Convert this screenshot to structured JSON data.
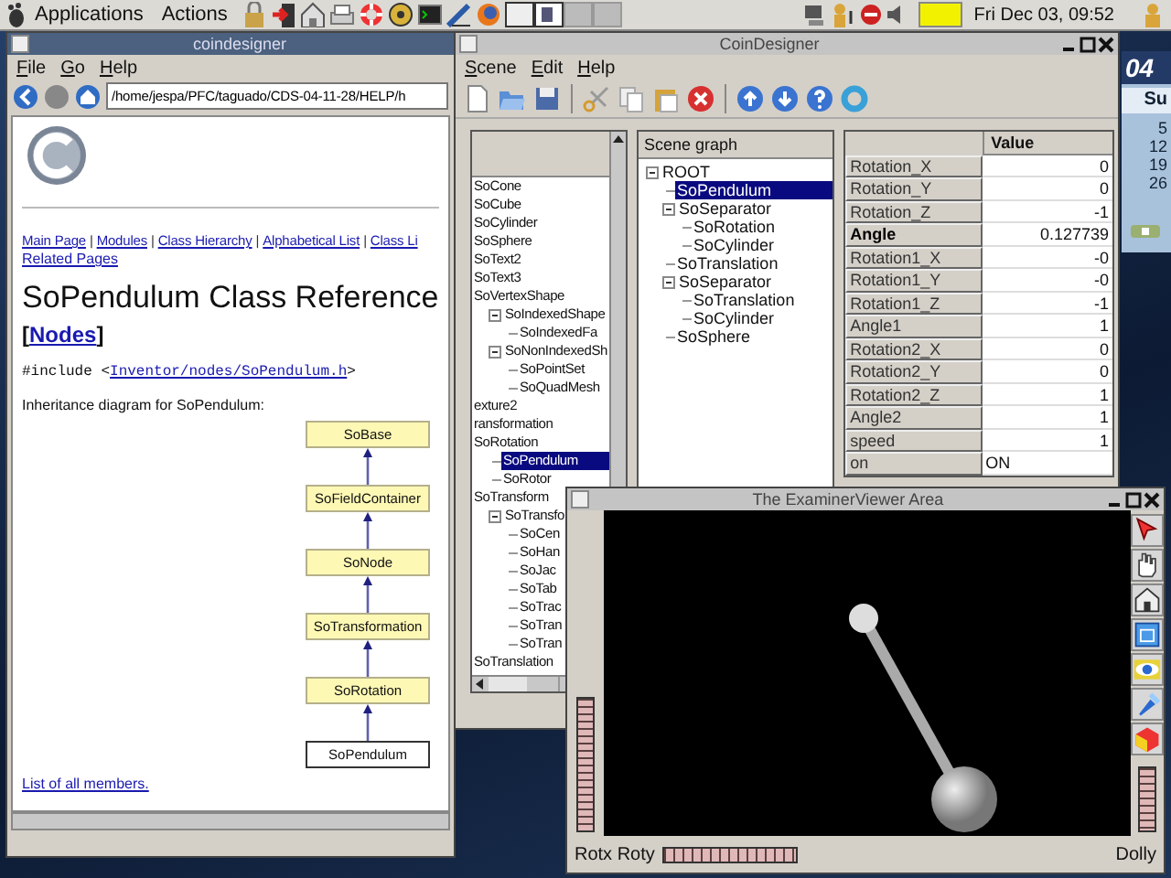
{
  "top_panel": {
    "menus": [
      "Applications",
      "Actions"
    ],
    "clock": "Fri Dec 03, 09:52"
  },
  "help_window": {
    "title": "coindesigner",
    "menu": [
      "File",
      "Go",
      "Help"
    ],
    "address": "/home/jespa/PFC/taguado/CDS-04-11-28/HELP/h",
    "nav_links": [
      "Main Page",
      "Modules",
      "Class Hierarchy",
      "Alphabetical List",
      "Class Li"
    ],
    "nav_separators": [
      "|",
      "|",
      "|",
      "|"
    ],
    "related_link": "Related Pages",
    "heading": "SoPendulum Class Reference",
    "group": {
      "open": "[",
      "link": "Nodes",
      "close": "]"
    },
    "include": {
      "prefix": "#include <",
      "link": "Inventor/nodes/SoPendulum.h",
      "suffix": ">"
    },
    "diagram_caption": "Inheritance diagram for SoPendulum:",
    "diagram": [
      {
        "label": "SoBase",
        "current": false
      },
      {
        "label": "SoFieldContainer",
        "current": false
      },
      {
        "label": "SoNode",
        "current": false
      },
      {
        "label": "SoTransformation",
        "current": false
      },
      {
        "label": "SoRotation",
        "current": false
      },
      {
        "label": "SoPendulum",
        "current": true
      }
    ],
    "members_link": "List of all members."
  },
  "coin_window": {
    "title": "CoinDesigner",
    "menu": [
      "Scene",
      "Edit",
      "Help"
    ],
    "class_list": [
      {
        "label": "SoCone",
        "selected": false
      },
      {
        "label": "SoCube",
        "selected": false
      },
      {
        "label": "SoCylinder",
        "selected": false
      },
      {
        "label": "SoSphere",
        "selected": false
      },
      {
        "label": "SoText2",
        "selected": false
      },
      {
        "label": "SoText3",
        "selected": false
      },
      {
        "label": "SoVertexShape",
        "selected": false,
        "children": [
          {
            "label": "SoIndexedShape",
            "selected": false,
            "expanded": true,
            "children": [
              {
                "label": "SoIndexedFa",
                "selected": false
              }
            ]
          },
          {
            "label": "SoNonIndexedSh",
            "selected": false,
            "expanded": true,
            "children": [
              {
                "label": "SoPointSet",
                "selected": false
              },
              {
                "label": "SoQuadMesh",
                "selected": false
              }
            ]
          }
        ]
      },
      {
        "label": "exture2",
        "selected": false
      },
      {
        "label": "ransformation",
        "selected": false
      },
      {
        "label": "SoRotation",
        "selected": false,
        "children": [
          {
            "label": "SoPendulum",
            "selected": true
          },
          {
            "label": "SoRotor",
            "selected": false
          }
        ]
      },
      {
        "label": "SoTransform",
        "selected": false,
        "children": [
          {
            "label": "SoTransfo",
            "selected": false,
            "expanded": true,
            "children": [
              {
                "label": "SoCen",
                "selected": false
              },
              {
                "label": "SoHan",
                "selected": false
              },
              {
                "label": "SoJac",
                "selected": false
              },
              {
                "label": "SoTab",
                "selected": false
              },
              {
                "label": "SoTrac",
                "selected": false
              },
              {
                "label": "SoTran",
                "selected": false
              },
              {
                "label": "SoTran",
                "selected": false
              }
            ]
          }
        ]
      },
      {
        "label": "SoTranslation",
        "selected": false
      }
    ],
    "scene_graph": {
      "header": "Scene graph",
      "nodes": [
        {
          "label": "ROOT",
          "selected": false,
          "expanded": true,
          "children": [
            {
              "label": "SoPendulum",
              "selected": true
            },
            {
              "label": "SoSeparator",
              "selected": false,
              "expanded": true,
              "children": [
                {
                  "label": "SoRotation",
                  "selected": false
                },
                {
                  "label": "SoCylinder",
                  "selected": false
                }
              ]
            },
            {
              "label": "SoTranslation",
              "selected": false
            },
            {
              "label": "SoSeparator",
              "selected": false,
              "expanded": true,
              "children": [
                {
                  "label": "SoTranslation",
                  "selected": false
                },
                {
                  "label": "SoCylinder",
                  "selected": false
                }
              ]
            },
            {
              "label": "SoSphere",
              "selected": false
            }
          ]
        }
      ]
    },
    "fields": {
      "header": "Value",
      "rows": [
        {
          "name": "Rotation_X",
          "value": "0",
          "kind": "number",
          "highlighted": false
        },
        {
          "name": "Rotation_Y",
          "value": "0",
          "kind": "number",
          "highlighted": false
        },
        {
          "name": "Rotation_Z",
          "value": "-1",
          "kind": "number",
          "highlighted": false
        },
        {
          "name": "Angle",
          "value": "0.127739",
          "kind": "number",
          "highlighted": true
        },
        {
          "name": "Rotation1_X",
          "value": "-0",
          "kind": "number",
          "highlighted": false
        },
        {
          "name": "Rotation1_Y",
          "value": "-0",
          "kind": "number",
          "highlighted": false
        },
        {
          "name": "Rotation1_Z",
          "value": "-1",
          "kind": "number",
          "highlighted": false
        },
        {
          "name": "Angle1",
          "value": "1",
          "kind": "number",
          "highlighted": false
        },
        {
          "name": "Rotation2_X",
          "value": "0",
          "kind": "number",
          "highlighted": false
        },
        {
          "name": "Rotation2_Y",
          "value": "0",
          "kind": "number",
          "highlighted": false
        },
        {
          "name": "Rotation2_Z",
          "value": "1",
          "kind": "number",
          "highlighted": false
        },
        {
          "name": "Angle2",
          "value": "1",
          "kind": "number",
          "highlighted": false
        },
        {
          "name": "speed",
          "value": "1",
          "kind": "number",
          "highlighted": false
        },
        {
          "name": "on",
          "value": "ON",
          "kind": "bool",
          "highlighted": false
        }
      ]
    }
  },
  "calendar": {
    "year": "04",
    "weekday": "Su",
    "days": [
      "5",
      "12",
      "19",
      "26"
    ]
  },
  "viewer_window": {
    "title": "The ExaminerViewer Area",
    "left_label": "Rotx Roty",
    "right_label": "Dolly"
  }
}
